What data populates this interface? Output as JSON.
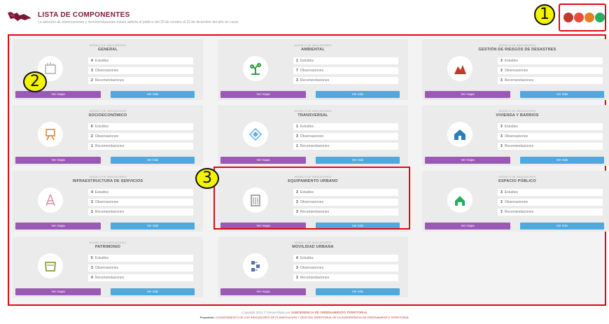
{
  "header": {
    "title": "LISTA DE COMPONENTES",
    "subtitle": "La atención de observaciones y recomendaciones estará abierta al público del 20 de octubre al 15 de diciembre del año en curso"
  },
  "callouts": [
    "1",
    "2",
    "3"
  ],
  "avatars": [
    {
      "color": "#c0392b",
      "name": "user-avatar-1"
    },
    {
      "color": "#e74c3c",
      "name": "user-avatar-2"
    },
    {
      "color": "#e67e22",
      "name": "user-avatar-3"
    },
    {
      "color": "#27ae60",
      "name": "user-avatar-4"
    }
  ],
  "cards": [
    {
      "category": "MODELO DE INDICADORES",
      "title": "GENERAL",
      "icon": "general-icon",
      "icon_color": "#b0b0b0",
      "stats": [
        {
          "n": "4",
          "label": "Estudios"
        },
        {
          "n": "3",
          "label": "Observaciones"
        },
        {
          "n": "2",
          "label": "Recomendaciones"
        }
      ],
      "btn1": "Ver mapa",
      "btn2": "Ver más"
    },
    {
      "category": "MODELO DE INDICADORES",
      "title": "AMBIENTAL",
      "icon": "ambiental-icon",
      "icon_color": "#2e9e44",
      "stats": [
        {
          "n": "1",
          "label": "Estudios"
        },
        {
          "n": "7",
          "label": "Observaciones"
        },
        {
          "n": "3",
          "label": "Recomendaciones"
        }
      ],
      "btn1": "Ver mapa",
      "btn2": "Ver más"
    },
    {
      "category": "MODELO DE INDICADORES",
      "title": "GESTIÓN DE RIESGOS DE DESASTRES",
      "icon": "riesgos-icon",
      "icon_color": "#c0392b",
      "stats": [
        {
          "n": "3",
          "label": "Estudios"
        },
        {
          "n": "3",
          "label": "Observaciones"
        },
        {
          "n": "3",
          "label": "Recomendaciones"
        }
      ],
      "btn1": "Ver mapa",
      "btn2": "Ver más"
    },
    {
      "category": "MODELO DE INDICADORES",
      "title": "SOCIOECONÓMICO",
      "icon": "socioeconomico-icon",
      "icon_color": "#e67e22",
      "stats": [
        {
          "n": "6",
          "label": "Estudios"
        },
        {
          "n": "2",
          "label": "Observaciones"
        },
        {
          "n": "1",
          "label": "Recomendaciones"
        }
      ],
      "btn1": "Ver mapa",
      "btn2": "Ver más"
    },
    {
      "category": "MODELO DE INDICADORES",
      "title": "TRANSVERSAL",
      "icon": "transversal-icon",
      "icon_color": "#5dade2",
      "stats": [
        {
          "n": "1",
          "label": "Estudios"
        },
        {
          "n": "3",
          "label": "Observaciones"
        },
        {
          "n": "1",
          "label": "Recomendaciones"
        }
      ],
      "btn1": "Ver mapa",
      "btn2": "Ver más"
    },
    {
      "category": "MODELO DE INDICADORES",
      "title": "VIVIENDA Y BARRIOS",
      "icon": "vivienda-icon",
      "icon_color": "#2980b9",
      "stats": [
        {
          "n": "3",
          "label": "Estudios"
        },
        {
          "n": "3",
          "label": "Observaciones"
        },
        {
          "n": "3",
          "label": "Recomendaciones"
        }
      ],
      "btn1": "Ver mapa",
      "btn2": "Ver más"
    },
    {
      "category": "MODELO DE INDICADORES",
      "title": "INFRAESTRUCTURA DE SERVICIOS",
      "icon": "infraestructura-icon",
      "icon_color": "#d98ea8",
      "stats": [
        {
          "n": "4",
          "label": "Estudios"
        },
        {
          "n": "3",
          "label": "Observaciones"
        },
        {
          "n": "2",
          "label": "Recomendaciones"
        }
      ],
      "btn1": "Ver mapa",
      "btn2": "Ver más"
    },
    {
      "category": "MODELO DE INDICADORES",
      "title": "EQUIPAMIENTO URBANO",
      "icon": "equipamiento-icon",
      "icon_color": "#8a8a8a",
      "stats": [
        {
          "n": "3",
          "label": "Estudios"
        },
        {
          "n": "3",
          "label": "Observaciones"
        },
        {
          "n": "3",
          "label": "Recomendaciones"
        }
      ],
      "btn1": "Ver mapa",
      "btn2": "Ver más"
    },
    {
      "category": "MODELO DE INDICADORES",
      "title": "ESPACIO PÚBLICO",
      "icon": "espacio-publico-icon",
      "icon_color": "#27ae60",
      "stats": [
        {
          "n": "3",
          "label": "Estudios"
        },
        {
          "n": "3",
          "label": "Observaciones"
        },
        {
          "n": "3",
          "label": "Recomendaciones"
        }
      ],
      "btn1": "Ver mapa",
      "btn2": "Ver más"
    },
    {
      "category": "MODELO DE INDICADORES",
      "title": "PATRIMONIO",
      "icon": "patrimonio-icon",
      "icon_color": "#7d8a1a",
      "stats": [
        {
          "n": "5",
          "label": "Estudios"
        },
        {
          "n": "3",
          "label": "Observaciones"
        },
        {
          "n": "4",
          "label": "Recomendaciones"
        }
      ],
      "btn1": "Ver mapa",
      "btn2": "Ver más"
    },
    {
      "category": "MODELO DE INDICADORES",
      "title": "MOVILIDAD URBANA",
      "icon": "movilidad-icon",
      "icon_color": "#5a6fb0",
      "stats": [
        {
          "n": "4",
          "label": "Estudios"
        },
        {
          "n": "3",
          "label": "Observaciones"
        },
        {
          "n": "3",
          "label": "Recomendaciones"
        }
      ],
      "btn1": "Ver mapa",
      "btn2": "Ver más"
    }
  ],
  "footer": {
    "copyright": "Copyright 2021 © Desarrollado por",
    "copyright_org": "SUBGERENCIA DE ORDENAMIENTO TERRITORIAL",
    "prepared_label": "Preparado:",
    "prepared_text": "LEVANTAMIENTO DE LOS INDICADORES DE PLANIFICACIÓN Y GESTIÓN TERRITORIAL DE LA SUBGERENCIA DE ORDENAMIENTO TERRITORIAL"
  }
}
